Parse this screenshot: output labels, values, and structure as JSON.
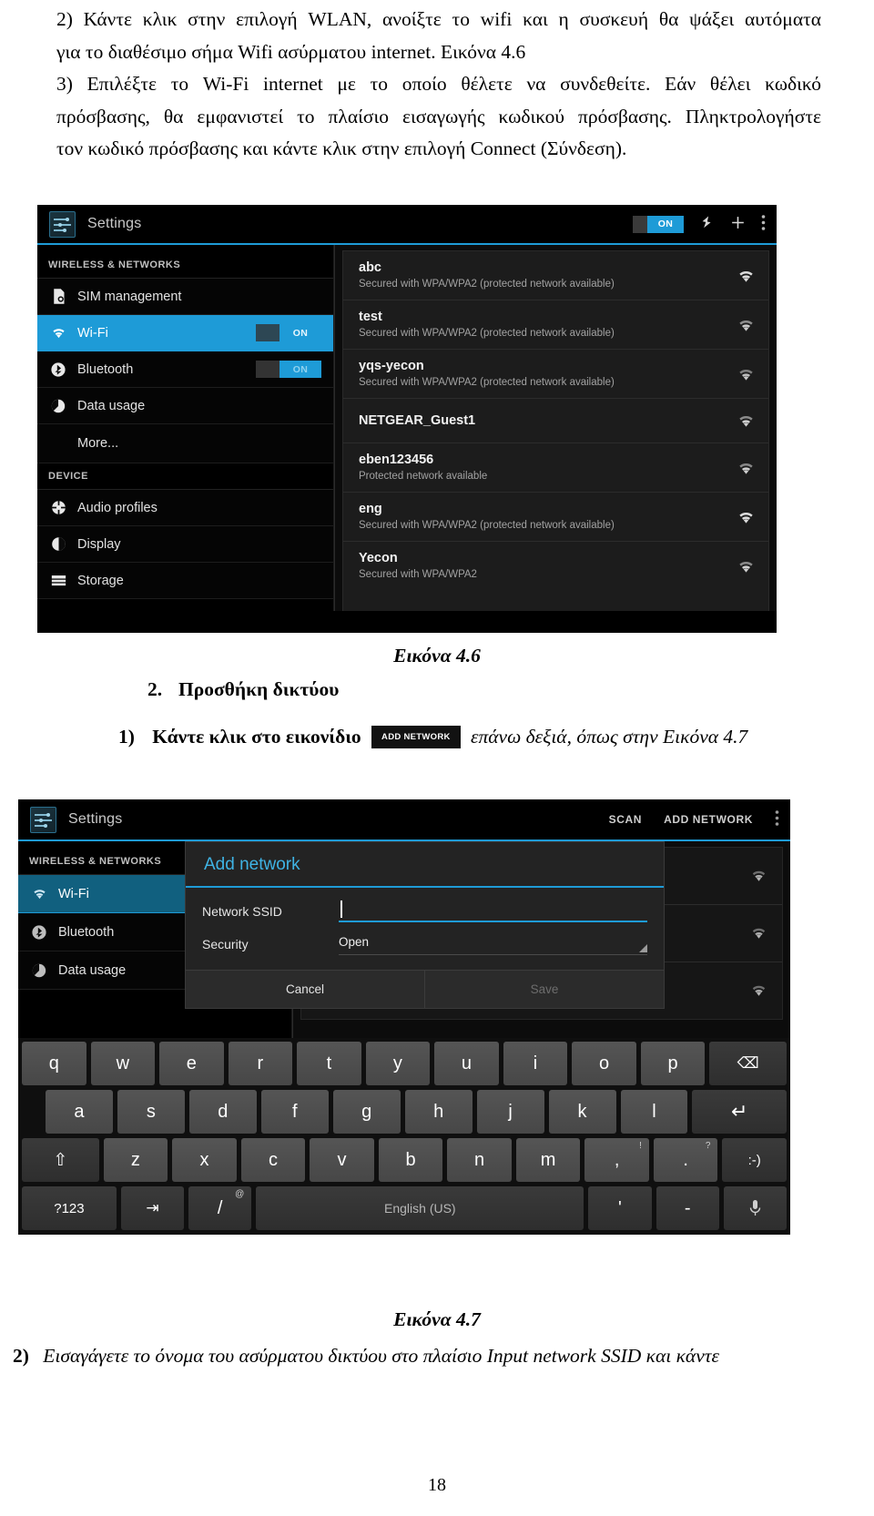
{
  "document": {
    "paragraphs": [
      "2) Κάντε κλικ στην επιλογή WLAN, ανοίξτε το wifi και η συσκευή θα ψάξει αυτόματα",
      "για το διαθέσιμο σήμα Wifi ασύρματου internet. Εικόνα 4.6",
      "3) Επιλέξτε το Wi-Fi internet με το οποίο θέλετε να συνδεθείτε. Εάν θέλει κωδικό",
      "πρόσβασης, θα εμφανιστεί το πλαίσιο εισαγωγής κωδικού πρόσβασης. Πληκτρολογήστε",
      "τον κωδικό πρόσβασης και κάντε κλικ στην επιλογή Connect (Σύνδεση)."
    ],
    "caption_46": "Εικόνα 4.6",
    "section_number": "2.",
    "section_title": "Προσθήκη δικτύου",
    "step1_number": "1)",
    "step1_before": "Κάντε κλικ στο εικονίδιο",
    "step1_chip": "ADD NETWORK",
    "step1_after": "επάνω δεξιά, όπως στην Εικόνα 4.7",
    "caption_47": "Εικόνα 4.7",
    "step2_number": "2)",
    "step2_text": "Εισαγάγετε το όνομα του ασύρματου δικτύου στο πλαίσιο Input network SSID και κάντε",
    "page_number": "18"
  },
  "screenshot_46": {
    "actionbar": {
      "app_title": "Settings",
      "wifi_toggle_label": "ON",
      "scan_icon": "scan-refresh-icon",
      "add_icon": "plus-icon",
      "overflow_icon": "overflow-menu-icon"
    },
    "sidebar": {
      "group_wireless": "WIRELESS & NETWORKS",
      "group_device": "DEVICE",
      "items": [
        {
          "label": "SIM management",
          "icon": "sim-card-icon",
          "toggle": null,
          "selected": false
        },
        {
          "label": "Wi-Fi",
          "icon": "wifi-icon",
          "toggle": "ON",
          "selected": true
        },
        {
          "label": "Bluetooth",
          "icon": "bluetooth-icon",
          "toggle": "ON",
          "selected": false
        },
        {
          "label": "Data usage",
          "icon": "data-usage-icon",
          "toggle": null,
          "selected": false
        },
        {
          "label": "More...",
          "icon": null,
          "toggle": null,
          "selected": false
        },
        {
          "label": "Audio profiles",
          "icon": "audio-profiles-icon",
          "toggle": null,
          "selected": false
        },
        {
          "label": "Display",
          "icon": "display-icon",
          "toggle": null,
          "selected": false
        },
        {
          "label": "Storage",
          "icon": "storage-icon",
          "toggle": null,
          "selected": false
        }
      ]
    },
    "networks": [
      {
        "ssid": "abc",
        "status": "Secured with WPA/WPA2 (protected network available)",
        "signal": 4
      },
      {
        "ssid": "test",
        "status": "Secured with WPA/WPA2 (protected network available)",
        "signal": 4
      },
      {
        "ssid": "yqs-yecon",
        "status": "Secured with WPA/WPA2 (protected network available)",
        "signal": 3
      },
      {
        "ssid": "NETGEAR_Guest1",
        "status": "",
        "signal": 3
      },
      {
        "ssid": "eben123456",
        "status": "Protected network available",
        "signal": 3
      },
      {
        "ssid": "eng",
        "status": "Secured with WPA/WPA2 (protected network available)",
        "signal": 4
      },
      {
        "ssid": "Yecon",
        "status": "Secured with WPA/WPA2",
        "signal": 3
      }
    ]
  },
  "screenshot_47": {
    "actionbar": {
      "app_title": "Settings",
      "scan_button": "SCAN",
      "add_network_button": "ADD NETWORK",
      "overflow_icon": "overflow-menu-icon"
    },
    "sidebar": {
      "group_wireless": "WIRELESS & NETWORKS",
      "items": [
        {
          "label": "Wi-Fi",
          "icon": "wifi-icon",
          "selected": true
        },
        {
          "label": "Bluetooth",
          "icon": "bluetooth-icon",
          "selected": false
        },
        {
          "label": "Data usage",
          "icon": "data-usage-icon",
          "selected": false
        }
      ]
    },
    "dialog": {
      "title": "Add network",
      "ssid_label": "Network SSID",
      "ssid_value": "",
      "security_label": "Security",
      "security_value": "Open",
      "cancel_label": "Cancel",
      "save_label": "Save"
    },
    "keyboard": {
      "row1": [
        "q",
        "w",
        "e",
        "r",
        "t",
        "y",
        "u",
        "i",
        "o",
        "p"
      ],
      "backspace": "⌫",
      "row2": [
        "a",
        "s",
        "d",
        "f",
        "g",
        "h",
        "j",
        "k",
        "l"
      ],
      "enter": "↵",
      "shift": "⇧",
      "row3": [
        "z",
        "x",
        "c",
        "v",
        "b",
        "n",
        "m"
      ],
      "comma": ",",
      "comma_sup": "!",
      "period": ".",
      "period_sup": "?",
      "emoji": ":-)",
      "symbols": "?123",
      "tab": "⇥",
      "slash": "/",
      "slash_sup": "@",
      "space_label": "English (US)",
      "apostrophe": "'",
      "dash": "-",
      "mic": "mic-icon"
    }
  },
  "colors": {
    "accent": "#1e9bd7",
    "dialog_title": "#3fb3e4",
    "panel_bg": "#1c1c1c",
    "key_bg": "#4a4a4a"
  }
}
